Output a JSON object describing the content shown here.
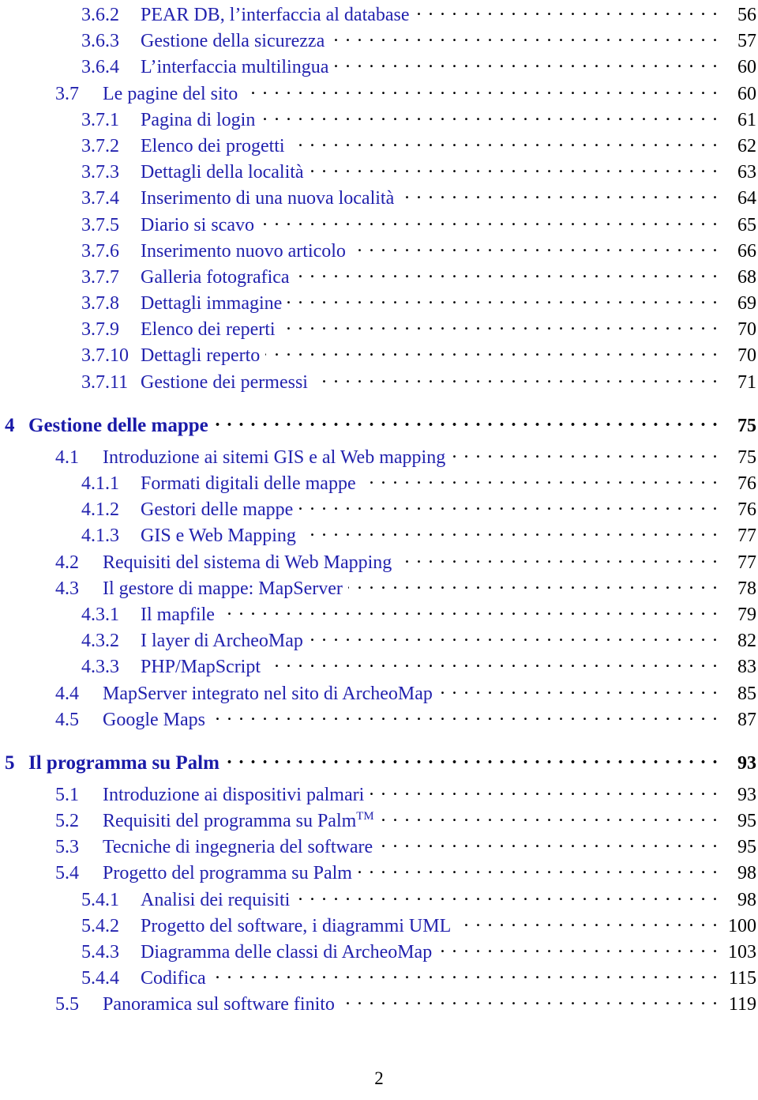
{
  "document": {
    "type": "table-of-contents",
    "footer_page_number": "2",
    "text_color": "#2222ae",
    "page_number_color": "#000000",
    "leader_style": "dotted"
  },
  "entries": [
    {
      "level": "subsection",
      "number": "3.6.2",
      "title": "PEAR DB, l’interfaccia al database",
      "page": "56"
    },
    {
      "level": "subsection",
      "number": "3.6.3",
      "title": "Gestione della sicurezza",
      "page": "57"
    },
    {
      "level": "subsection",
      "number": "3.6.4",
      "title": "L’interfaccia multilingua",
      "page": "60"
    },
    {
      "level": "section",
      "number": "3.7",
      "title": "Le pagine del sito",
      "page": "60"
    },
    {
      "level": "subsection",
      "number": "3.7.1",
      "title": "Pagina di login",
      "page": "61"
    },
    {
      "level": "subsection",
      "number": "3.7.2",
      "title": "Elenco dei progetti",
      "page": "62"
    },
    {
      "level": "subsection",
      "number": "3.7.3",
      "title": "Dettagli della località",
      "page": "63"
    },
    {
      "level": "subsection",
      "number": "3.7.4",
      "title": "Inserimento di una nuova località",
      "page": "64"
    },
    {
      "level": "subsection",
      "number": "3.7.5",
      "title": "Diario si scavo",
      "page": "65"
    },
    {
      "level": "subsection",
      "number": "3.7.6",
      "title": "Inserimento nuovo articolo",
      "page": "66"
    },
    {
      "level": "subsection",
      "number": "3.7.7",
      "title": "Galleria fotografica",
      "page": "68"
    },
    {
      "level": "subsection",
      "number": "3.7.8",
      "title": "Dettagli immagine",
      "page": "69"
    },
    {
      "level": "subsection",
      "number": "3.7.9",
      "title": "Elenco dei reperti",
      "page": "70"
    },
    {
      "level": "subsection",
      "number": "3.7.10",
      "title": "Dettagli reperto",
      "page": "70"
    },
    {
      "level": "subsection",
      "number": "3.7.11",
      "title": "Gestione dei permessi",
      "page": "71"
    },
    {
      "level": "chapter",
      "number": "4",
      "title": "Gestione delle mappe",
      "page": "75"
    },
    {
      "level": "section",
      "number": "4.1",
      "title": "Introduzione ai sitemi GIS e al Web mapping",
      "page": "75"
    },
    {
      "level": "subsection",
      "number": "4.1.1",
      "title": "Formati digitali delle mappe",
      "page": "76"
    },
    {
      "level": "subsection",
      "number": "4.1.2",
      "title": "Gestori delle mappe",
      "page": "76"
    },
    {
      "level": "subsection",
      "number": "4.1.3",
      "title": "GIS e Web Mapping",
      "page": "77"
    },
    {
      "level": "section",
      "number": "4.2",
      "title": "Requisiti del sistema di Web Mapping",
      "page": "77"
    },
    {
      "level": "section",
      "number": "4.3",
      "title": "Il gestore di mappe: MapServer",
      "page": "78"
    },
    {
      "level": "subsection",
      "number": "4.3.1",
      "title": "Il mapfile",
      "page": "79"
    },
    {
      "level": "subsection",
      "number": "4.3.2",
      "title": "I layer di ArcheoMap",
      "page": "82"
    },
    {
      "level": "subsection",
      "number": "4.3.3",
      "title": "PHP/MapScript",
      "page": "83"
    },
    {
      "level": "section",
      "number": "4.4",
      "title": "MapServer integrato nel sito di ArcheoMap",
      "page": "85"
    },
    {
      "level": "section",
      "number": "4.5",
      "title": "Google Maps",
      "page": "87"
    },
    {
      "level": "chapter",
      "number": "5",
      "title": "Il programma su Palm",
      "page": "93"
    },
    {
      "level": "section",
      "number": "5.1",
      "title": "Introduzione ai dispositivi palmari",
      "page": "93"
    },
    {
      "level": "section",
      "number": "5.2",
      "title": "Requisiti del programma su Palm",
      "title_sup": "TM",
      "page": "95"
    },
    {
      "level": "section",
      "number": "5.3",
      "title": "Tecniche di ingegneria del software",
      "page": "95"
    },
    {
      "level": "section",
      "number": "5.4",
      "title": "Progetto del programma su Palm",
      "page": "98"
    },
    {
      "level": "subsection",
      "number": "5.4.1",
      "title": "Analisi dei requisiti",
      "page": "98"
    },
    {
      "level": "subsection",
      "number": "5.4.2",
      "title": "Progetto del software, i diagrammi UML",
      "page": "100"
    },
    {
      "level": "subsection",
      "number": "5.4.3",
      "title": "Diagramma delle classi di ArcheoMap",
      "page": "103"
    },
    {
      "level": "subsection",
      "number": "5.4.4",
      "title": "Codifica",
      "page": "115"
    },
    {
      "level": "section",
      "number": "5.5",
      "title": "Panoramica sul software finito",
      "page": "119"
    }
  ]
}
